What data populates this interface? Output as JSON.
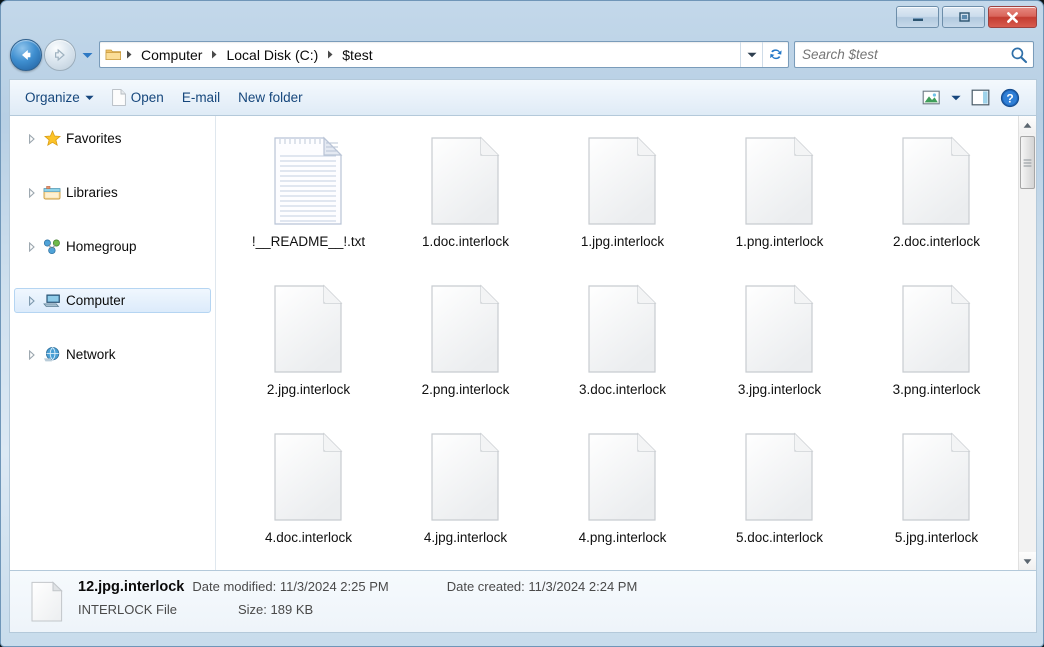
{
  "window": {
    "title": "",
    "controls": {
      "minimize": "Minimize",
      "maximize": "Maximize",
      "close": "Close"
    }
  },
  "address": {
    "back_tooltip": "Back",
    "forward_tooltip": "Forward",
    "history_tooltip": "Recent pages",
    "folder_icon": "folder-icon",
    "breadcrumb": [
      "Computer",
      "Local Disk (C:)",
      "$test"
    ],
    "dropdown_tooltip": "Previous locations",
    "refresh_tooltip": "Refresh"
  },
  "search": {
    "placeholder": "Search $test",
    "value": "",
    "icon": "search-icon"
  },
  "toolbar": {
    "organize_label": "Organize",
    "open_label": "Open",
    "email_label": "E-mail",
    "new_folder_label": "New folder",
    "view_icon": "change-view-icon",
    "view_dropdown_icon": "chevron-down-icon",
    "preview_pane_icon": "preview-pane-icon",
    "help_icon": "help-icon"
  },
  "sidebar": {
    "items": [
      {
        "label": "Favorites",
        "icon": "star-icon",
        "selected": false,
        "expandable": true
      },
      {
        "label": "Libraries",
        "icon": "libraries-icon",
        "selected": false,
        "expandable": true
      },
      {
        "label": "Homegroup",
        "icon": "homegroup-icon",
        "selected": false,
        "expandable": true
      },
      {
        "label": "Computer",
        "icon": "computer-icon",
        "selected": true,
        "expandable": true
      },
      {
        "label": "Network",
        "icon": "network-icon",
        "selected": false,
        "expandable": true
      }
    ]
  },
  "files": [
    {
      "name": "!__README__!.txt",
      "icon": "text-file-icon"
    },
    {
      "name": "1.doc.interlock",
      "icon": "generic-file-icon"
    },
    {
      "name": "1.jpg.interlock",
      "icon": "generic-file-icon"
    },
    {
      "name": "1.png.interlock",
      "icon": "generic-file-icon"
    },
    {
      "name": "2.doc.interlock",
      "icon": "generic-file-icon"
    },
    {
      "name": "2.jpg.interlock",
      "icon": "generic-file-icon"
    },
    {
      "name": "2.png.interlock",
      "icon": "generic-file-icon"
    },
    {
      "name": "3.doc.interlock",
      "icon": "generic-file-icon"
    },
    {
      "name": "3.jpg.interlock",
      "icon": "generic-file-icon"
    },
    {
      "name": "3.png.interlock",
      "icon": "generic-file-icon"
    },
    {
      "name": "4.doc.interlock",
      "icon": "generic-file-icon"
    },
    {
      "name": "4.jpg.interlock",
      "icon": "generic-file-icon"
    },
    {
      "name": "4.png.interlock",
      "icon": "generic-file-icon"
    },
    {
      "name": "5.doc.interlock",
      "icon": "generic-file-icon"
    },
    {
      "name": "5.jpg.interlock",
      "icon": "generic-file-icon"
    }
  ],
  "details": {
    "filename": "12.jpg.interlock",
    "date_modified_label": "Date modified:",
    "date_modified_value": "11/3/2024 2:25 PM",
    "date_created_label": "Date created:",
    "date_created_value": "11/3/2024 2:24 PM",
    "file_type": "INTERLOCK File",
    "size_label": "Size:",
    "size_value": "189 KB"
  },
  "scrollbar": {
    "up_arrow": "scroll-up-icon",
    "down_arrow": "scroll-down-icon"
  },
  "colors": {
    "accent": "#1f5d9c",
    "close_red": "#c33c31",
    "selection_blue": "#dcebfb",
    "frame_blue": "#b7cfe4"
  }
}
